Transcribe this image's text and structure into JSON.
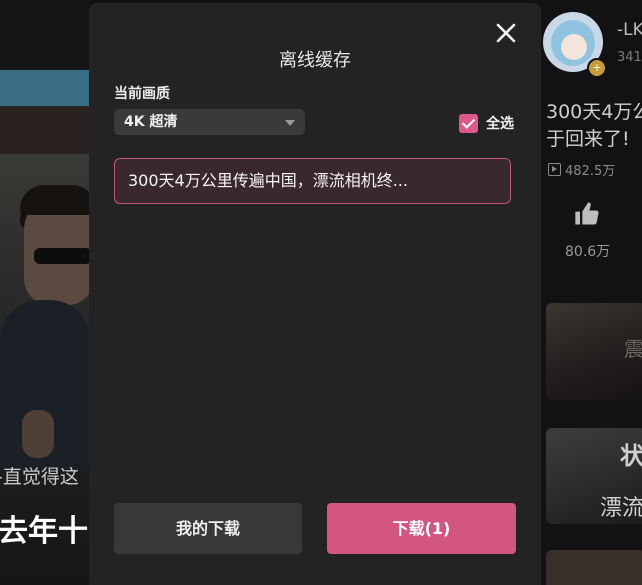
{
  "dialog": {
    "title": "离线缓存",
    "quality_label": "当前画质",
    "quality_value": "4K 超清",
    "select_all_label": "全选",
    "select_all_checked": true,
    "items": [
      "300天4万公里传遍中国，漂流相机终..."
    ],
    "my_downloads_label": "我的下载",
    "download_label": "下载(1)",
    "accent_color": "#d2567f"
  },
  "background": {
    "caption_line1": "-直觉得这",
    "caption_line2": "去年十",
    "uploader_name": "-LK",
    "uploader_fans": "341",
    "video_title_line1": "300天4万公",
    "video_title_line2": "于回来了!",
    "views": "482.5万",
    "likes": "80.6万",
    "thumb1_text": "震",
    "thumb2_text_top": "状",
    "thumb2_text": "漂流"
  }
}
